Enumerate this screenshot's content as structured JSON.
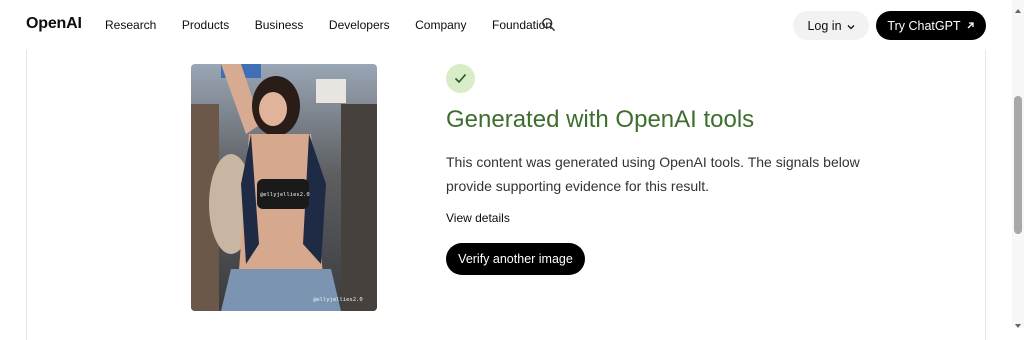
{
  "header": {
    "logo": "OpenAI",
    "nav": [
      "Research",
      "Products",
      "Business",
      "Developers",
      "Company",
      "Foundation"
    ],
    "search_icon": "search-icon",
    "login_label": "Log in",
    "cta_label": "Try ChatGPT"
  },
  "result": {
    "status_icon": "check-icon",
    "status_color": "#3e6e2d",
    "title": "Generated with OpenAI tools",
    "description": "This content was generated using OpenAI tools. The signals below provide supporting evidence for this result.",
    "details_link": "View details",
    "verify_button": "Verify another image"
  },
  "image": {
    "watermark_top": "@ellyjellies2.0",
    "watermark_bottom": "@ellyjellies2.0"
  }
}
